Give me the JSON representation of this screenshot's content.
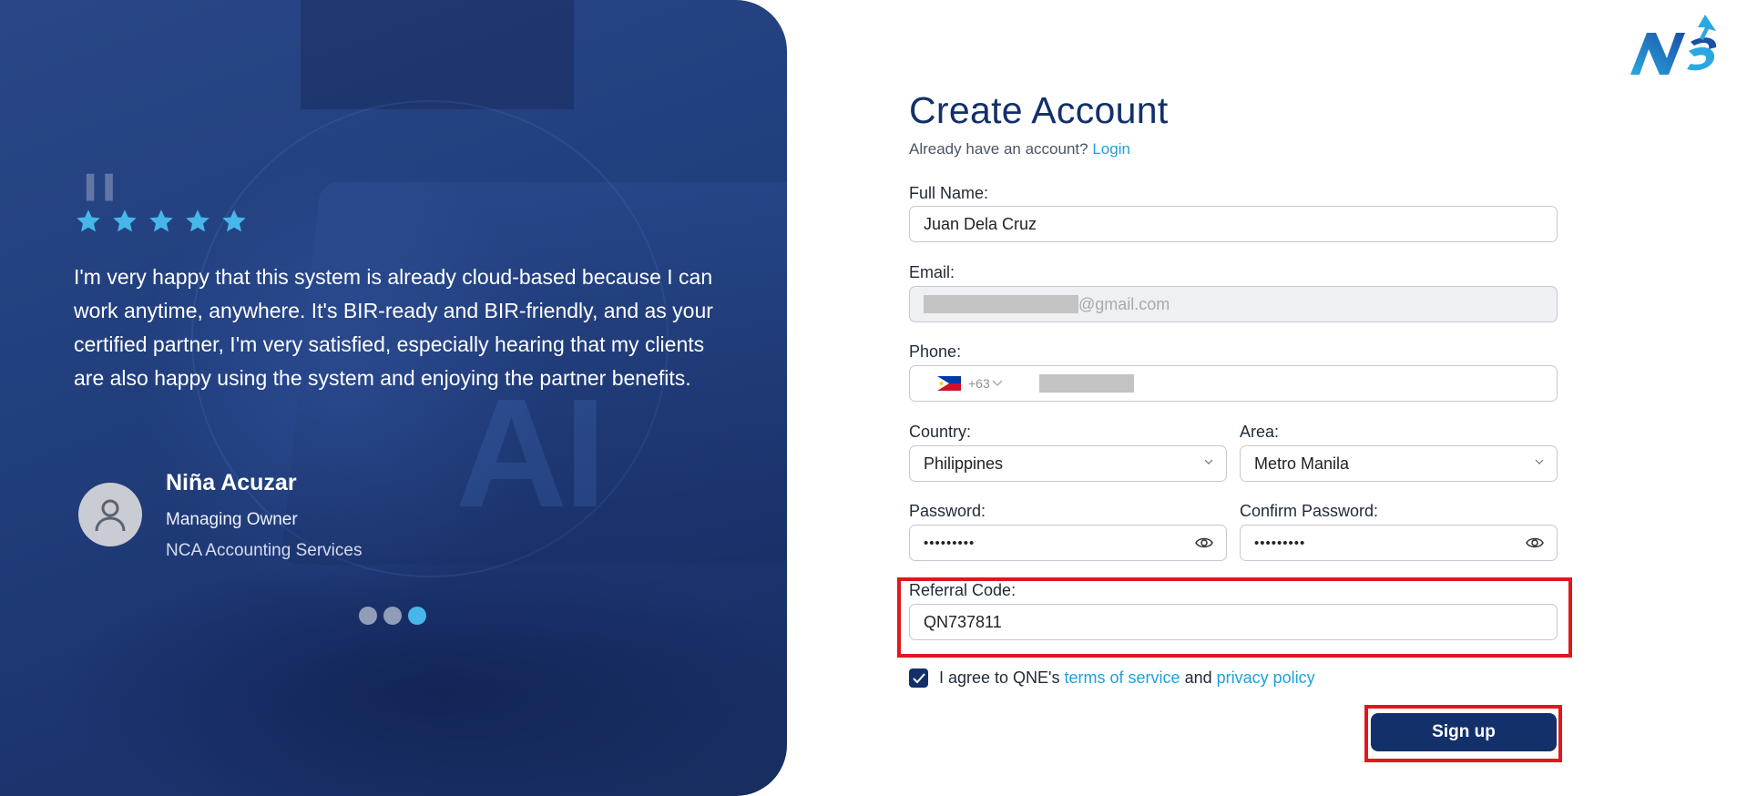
{
  "testimonial": {
    "rating": 5,
    "quote": "I'm very happy that this system is already cloud-based because I can work anytime, anywhere. It's BIR-ready and BIR-friendly, and as your certified partner, I'm very satisfied, especially hearing that my clients are also happy using the system and enjoying the partner benefits.",
    "author_name": "Niña Acuzar",
    "author_role": "Managing Owner",
    "author_company": "NCA Accounting Services",
    "slides_total": 3,
    "active_slide": 3
  },
  "form": {
    "title": "Create Account",
    "login_prompt": "Already have an account?",
    "login_link": "Login",
    "full_name_label": "Full Name",
    "full_name_value": "Juan Dela Cruz",
    "email_label": "Email",
    "email_domain": "@gmail.com",
    "phone_label": "Phone",
    "phone_code": "+63",
    "country_label": "Country",
    "country_value": "Philippines",
    "area_label": "Area",
    "area_value": "Metro Manila",
    "password_label": "Password",
    "password_value": "•••••••••",
    "confirm_password_label": "Confirm Password",
    "confirm_password_value": "•••••••••",
    "referral_label": "Referral Code",
    "referral_value": "QN737811",
    "agree_prefix": "I agree to QNE's",
    "terms_link": "terms of service",
    "agree_and": "and",
    "privacy_link": "privacy policy",
    "agree_checked": true,
    "signup_label": "Sign up",
    "label_suffix": ":"
  },
  "colors": {
    "brand_navy": "#13306a",
    "link_blue": "#1ba1de",
    "highlight_red": "#e0181c",
    "star_blue": "#47b7ea"
  },
  "icons": {
    "star": "star-icon",
    "avatar": "user-icon",
    "flag": "philippines-flag-icon",
    "chevron": "chevron-down-icon",
    "eye": "eye-icon",
    "check": "check-icon"
  }
}
